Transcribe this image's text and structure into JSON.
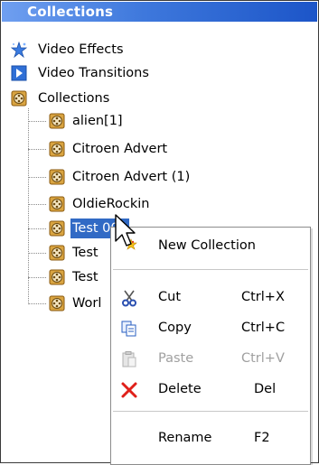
{
  "header": {
    "title": "Collections"
  },
  "tree": {
    "roots": [
      {
        "label": "Video Effects",
        "icon": "star-icon"
      },
      {
        "label": "Video Transitions",
        "icon": "transition-icon"
      },
      {
        "label": "Collections",
        "icon": "film-reel-icon"
      }
    ],
    "collections": [
      {
        "label": "alien[1]"
      },
      {
        "label": "Citroen Advert"
      },
      {
        "label": "Citroen Advert (1)"
      },
      {
        "label": "OldieRockin"
      },
      {
        "label": "Test 001",
        "selected": true
      },
      {
        "label": "Test"
      },
      {
        "label": "Test"
      },
      {
        "label": "Worl"
      }
    ]
  },
  "context_menu": {
    "new_collection": {
      "label": "New Collection"
    },
    "cut": {
      "label": "Cut",
      "shortcut": "Ctrl+X"
    },
    "copy": {
      "label": "Copy",
      "shortcut": "Ctrl+C"
    },
    "paste": {
      "label": "Paste",
      "shortcut": "Ctrl+V",
      "disabled": true
    },
    "delete": {
      "label": "Delete",
      "shortcut": "Del"
    },
    "rename": {
      "label": "Rename",
      "shortcut": "F2"
    }
  }
}
